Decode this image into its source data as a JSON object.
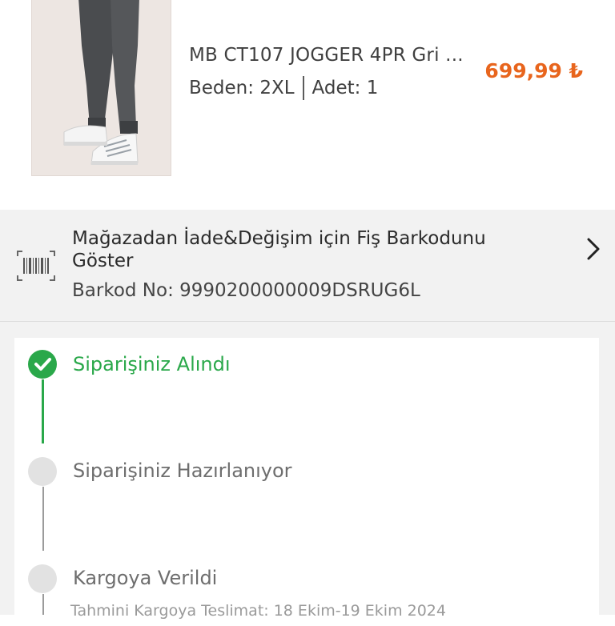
{
  "product": {
    "name": "MB CT107 JOGGER 4PR Gri ...",
    "size_text": "Beden: 2XL",
    "qty_text": "Adet: 1",
    "price": "699,99 ₺",
    "image_icon": "product-image"
  },
  "barcode_banner": {
    "title": "Mağazadan İade&Değişim için Fiş Barkodunu Göster",
    "barcode_no": "Barkod No: 9990200000009DSRUG6L",
    "icon": "barcode-icon",
    "chevron_icon": "chevron-right-icon"
  },
  "status_steps": [
    {
      "label": "Siparişiniz Alındı",
      "state": "done"
    },
    {
      "label": "Siparişiniz Hazırlanıyor",
      "state": "pending"
    },
    {
      "label": "Kargoya Verildi",
      "state": "pending"
    }
  ],
  "estimate_text": "Tahmini Kargoya Teslimat: 18 Ekim-19 Ekim 2024",
  "colors": {
    "price": "#e8651d",
    "success": "#2aa84a",
    "pending": "#e2e2e2",
    "banner_bg": "#f2f2f2"
  }
}
